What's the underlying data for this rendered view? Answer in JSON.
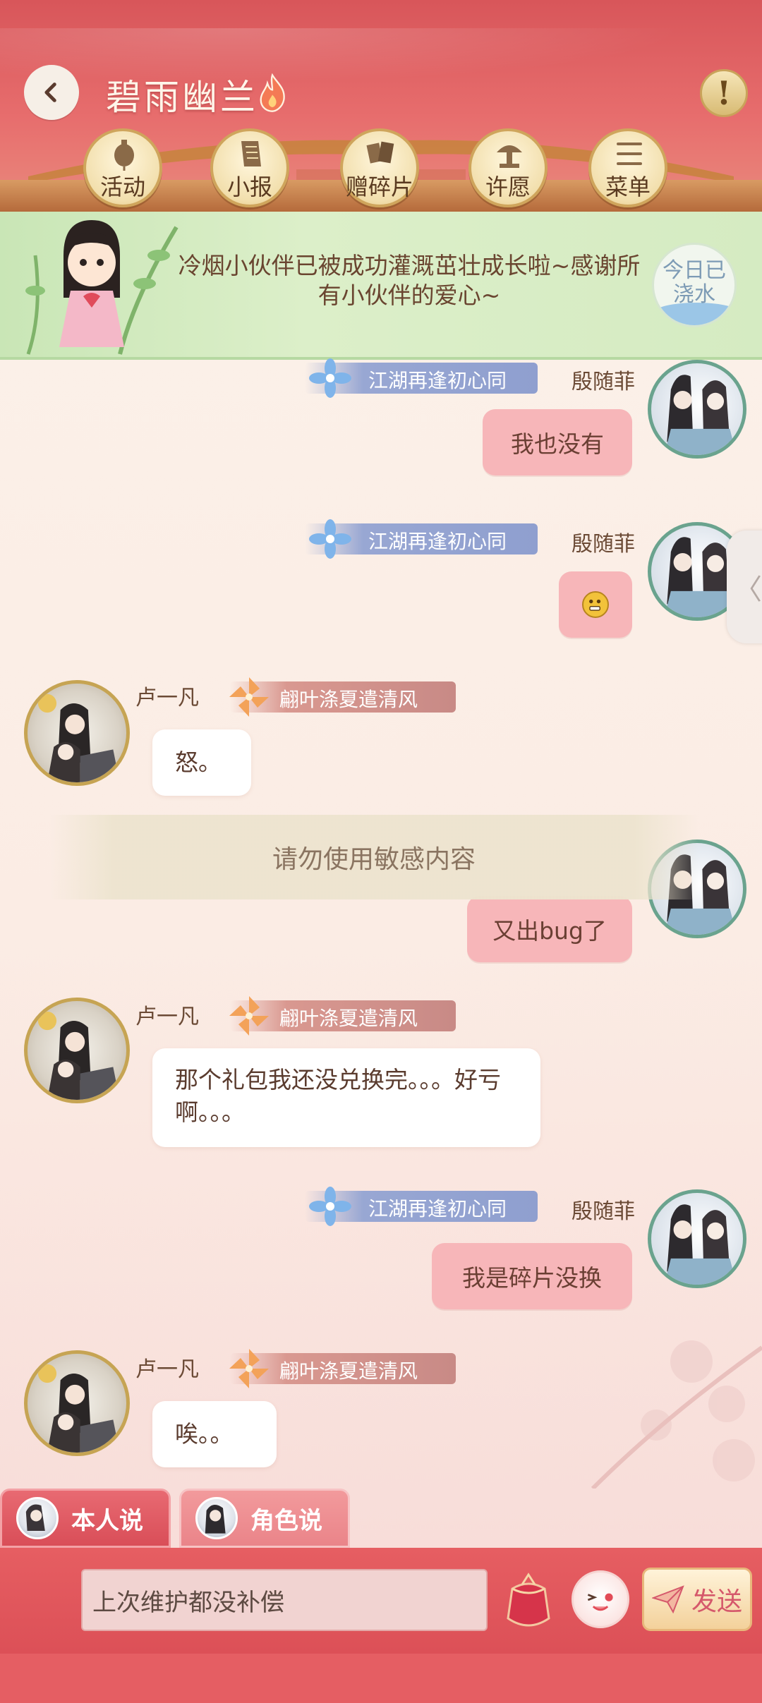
{
  "header": {
    "title": "碧雨幽兰",
    "alert_symbol": "!",
    "nav": [
      {
        "label": "活动",
        "icon": "lantern-icon"
      },
      {
        "label": "小报",
        "icon": "scroll-icon"
      },
      {
        "label": "赠碎片",
        "icon": "fragment-icon"
      },
      {
        "label": "许愿",
        "icon": "fountain-icon"
      },
      {
        "label": "菜单",
        "icon": "menu-icon"
      }
    ]
  },
  "banner": {
    "message": "冷烟小伙伴已被成功灌溉茁壮成长啦~感谢所有小伙伴的爱心~",
    "badge": "今日已浇水"
  },
  "chat": {
    "messages": [
      {
        "side": "right",
        "name": "殷随菲",
        "tag": "江湖再逢初心同",
        "text": "我也没有"
      },
      {
        "side": "right",
        "name": "殷随菲",
        "tag": "江湖再逢初心同",
        "text": "",
        "emoji": "grimace-emoji"
      },
      {
        "side": "left",
        "name": "卢一凡",
        "tag": "翩叶涤夏遣清风",
        "text": "怒。"
      },
      {
        "side": "right",
        "name": "殷随菲",
        "tag": "",
        "text": "又出bug了"
      },
      {
        "side": "left",
        "name": "卢一凡",
        "tag": "翩叶涤夏遣清风",
        "text": "那个礼包我还没兑换完。。。好亏啊。。。"
      },
      {
        "side": "right",
        "name": "殷随菲",
        "tag": "江湖再逢初心同",
        "text": "我是碎片没换"
      },
      {
        "side": "left",
        "name": "卢一凡",
        "tag": "翩叶涤夏遣清风",
        "text": "唉。。"
      }
    ],
    "toast": "请勿使用敏感内容",
    "side_tab": "〈"
  },
  "composer": {
    "mode_self": "本人说",
    "mode_role": "角色说",
    "input_value": "上次维护都没补偿",
    "send_label": "发送"
  },
  "colors": {
    "header_red": "#d8565a",
    "bubble_right": "#f7b6b9",
    "bubble_left": "#ffffff",
    "send_text": "#d5586b"
  }
}
